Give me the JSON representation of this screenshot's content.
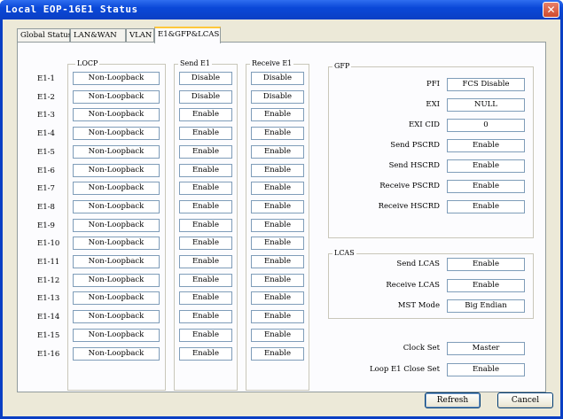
{
  "window": {
    "title": "Local EOP-16E1 Status"
  },
  "tabs": [
    {
      "label": "Global Status"
    },
    {
      "label": "LAN&WAN"
    },
    {
      "label": "VLAN"
    },
    {
      "label": "E1&GFP&LCAS"
    }
  ],
  "e1": {
    "locp_label": "LOCP",
    "send_label": "Send E1",
    "receive_label": "Receive E1",
    "rows": [
      {
        "label": "E1-1",
        "locp": "Non-Loopback",
        "send": "Disable",
        "receive": "Disable"
      },
      {
        "label": "E1-2",
        "locp": "Non-Loopback",
        "send": "Disable",
        "receive": "Disable"
      },
      {
        "label": "E1-3",
        "locp": "Non-Loopback",
        "send": "Enable",
        "receive": "Enable"
      },
      {
        "label": "E1-4",
        "locp": "Non-Loopback",
        "send": "Enable",
        "receive": "Enable"
      },
      {
        "label": "E1-5",
        "locp": "Non-Loopback",
        "send": "Enable",
        "receive": "Enable"
      },
      {
        "label": "E1-6",
        "locp": "Non-Loopback",
        "send": "Enable",
        "receive": "Enable"
      },
      {
        "label": "E1-7",
        "locp": "Non-Loopback",
        "send": "Enable",
        "receive": "Enable"
      },
      {
        "label": "E1-8",
        "locp": "Non-Loopback",
        "send": "Enable",
        "receive": "Enable"
      },
      {
        "label": "E1-9",
        "locp": "Non-Loopback",
        "send": "Enable",
        "receive": "Enable"
      },
      {
        "label": "E1-10",
        "locp": "Non-Loopback",
        "send": "Enable",
        "receive": "Enable"
      },
      {
        "label": "E1-11",
        "locp": "Non-Loopback",
        "send": "Enable",
        "receive": "Enable"
      },
      {
        "label": "E1-12",
        "locp": "Non-Loopback",
        "send": "Enable",
        "receive": "Enable"
      },
      {
        "label": "E1-13",
        "locp": "Non-Loopback",
        "send": "Enable",
        "receive": "Enable"
      },
      {
        "label": "E1-14",
        "locp": "Non-Loopback",
        "send": "Enable",
        "receive": "Enable"
      },
      {
        "label": "E1-15",
        "locp": "Non-Loopback",
        "send": "Enable",
        "receive": "Enable"
      },
      {
        "label": "E1-16",
        "locp": "Non-Loopback",
        "send": "Enable",
        "receive": "Enable"
      }
    ]
  },
  "gfp": {
    "label": "GFP",
    "rows": [
      {
        "label": "PFI",
        "value": "FCS Disable"
      },
      {
        "label": "EXI",
        "value": "NULL"
      },
      {
        "label": "EXI CID",
        "value": "0"
      },
      {
        "label": "Send PSCRD",
        "value": "Enable"
      },
      {
        "label": "Send HSCRD",
        "value": "Enable"
      },
      {
        "label": "Receive PSCRD",
        "value": "Enable"
      },
      {
        "label": "Receive HSCRD",
        "value": "Enable"
      }
    ]
  },
  "lcas": {
    "label": "LCAS",
    "rows": [
      {
        "label": "Send LCAS",
        "value": "Enable"
      },
      {
        "label": "Receive LCAS",
        "value": "Enable"
      },
      {
        "label": "MST Mode",
        "value": "Big Endian"
      }
    ]
  },
  "misc": {
    "rows": [
      {
        "label": "Clock Set",
        "value": "Master"
      },
      {
        "label": "Loop E1 Close Set",
        "value": "Enable"
      }
    ]
  },
  "buttons": {
    "refresh": "Refresh",
    "cancel": "Cancel"
  }
}
